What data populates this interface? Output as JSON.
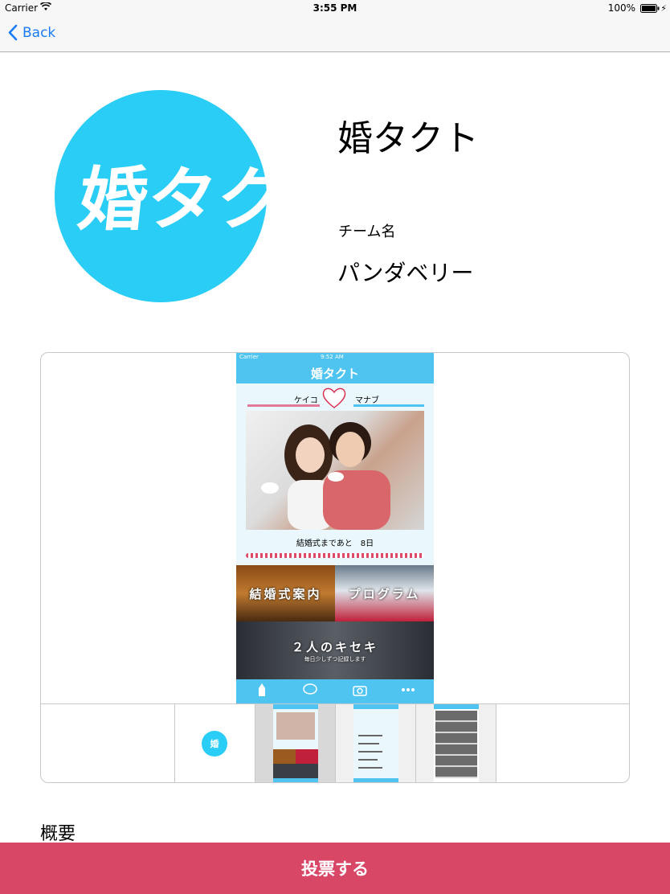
{
  "status_bar": {
    "carrier": "Carrier",
    "time": "3:55 PM",
    "battery": "100%"
  },
  "nav": {
    "back_label": "Back"
  },
  "header": {
    "app_icon_text": "婚タクト",
    "app_name": "婚タクト",
    "team_label": "チーム名",
    "team_name": "パンダベリー"
  },
  "screenshot": {
    "status_carrier": "Carrier",
    "status_time": "9:52 AM",
    "app_logo": "婚タクト",
    "groom_name": "ケイコ",
    "bride_name": "マナブ",
    "countdown": "結婚式まであと　8日",
    "tiles": {
      "wedding_info": "結婚式案内",
      "program": "プログラム",
      "kiseki": "２人のキセキ",
      "kiseki_sub": "毎日少しずつ記録します"
    }
  },
  "thumbnails": {
    "icon_text": "婚"
  },
  "overview": {
    "heading": "概要"
  },
  "actions": {
    "vote_label": "投票する"
  },
  "colors": {
    "accent": "#1a7cf5",
    "vote_button": "#d84766",
    "icon_bg": "#29cdf5",
    "app_blue": "#4fc4f0"
  }
}
